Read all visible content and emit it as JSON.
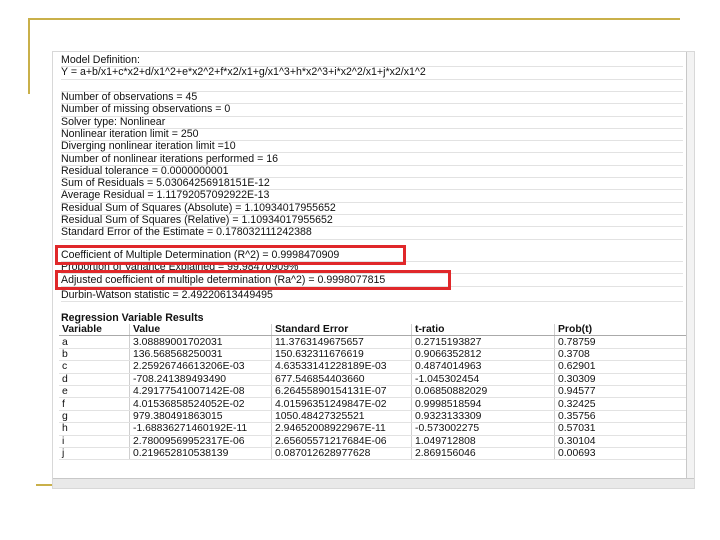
{
  "model": {
    "definition_label": "Model Definition:",
    "equation": "Y = a+b/x1+c*x2+d/x1^2+e*x2^2+f*x2/x1+g/x1^3+h*x2^3+i*x2^2/x1+j*x2/x1^2"
  },
  "stats": [
    "Number of observations = 45",
    "Number of missing observations = 0",
    "Solver type: Nonlinear",
    "Nonlinear iteration limit = 250",
    "Diverging nonlinear iteration limit =10",
    "Number of nonlinear iterations performed = 16",
    "Residual tolerance = 0.0000000001",
    "Sum of Residuals = 5.03064256918151E-12",
    "Average Residual = 1.11792057092922E-13",
    "Residual Sum of Squares (Absolute) = 1.10934017955652",
    "Residual Sum of Squares (Relative) = 1.10934017955652",
    "Standard Error of the Estimate = 0.178032111242388",
    "Coefficient of Multiple Determination (R^2) = 0.9998470909",
    "Proportion of Variance Explained = 99.98470909%",
    "Adjusted coefficient of multiple determination (Ra^2) = 0.9998077815",
    "Durbin-Watson statistic = 2.49220613449495"
  ],
  "results": {
    "title": "Regression Variable Results",
    "headers": [
      "Variable",
      "Value",
      "Standard Error",
      "t-ratio",
      "Prob(t)"
    ],
    "rows": [
      [
        "a",
        "3.08889001702031",
        "11.3763149675657",
        "0.2715193827",
        "0.78759"
      ],
      [
        "b",
        "136.568568250031",
        "150.632311676619",
        "0.9066352812",
        "0.3708"
      ],
      [
        "c",
        "2.25926746613206E-03",
        "4.63533141228189E-03",
        "0.4874014963",
        "0.62901"
      ],
      [
        "d",
        "-708.241389493490",
        "677.546854403660",
        "-1.045302454",
        "0.30309"
      ],
      [
        "e",
        "4.29177541007142E-08",
        "6.26455890154131E-07",
        "0.06850882029",
        "0.94577"
      ],
      [
        "f",
        "4.01536858524052E-02",
        "4.01596351249847E-02",
        "0.9998518594",
        "0.32425"
      ],
      [
        "g",
        "979.380491863015",
        "1050.48427325521",
        "0.9323133309",
        "0.35756"
      ],
      [
        "h",
        "-1.68836271460192E-11",
        "2.94652008922967E-11",
        "-0.573002275",
        "0.57031"
      ],
      [
        "i",
        "2.78009569952317E-06",
        "2.65605571217684E-06",
        "1.049712808",
        "0.30104"
      ],
      [
        "j",
        "0.219652810538139",
        "0.087012628977628",
        "2.869156046",
        "0.00693"
      ]
    ]
  }
}
